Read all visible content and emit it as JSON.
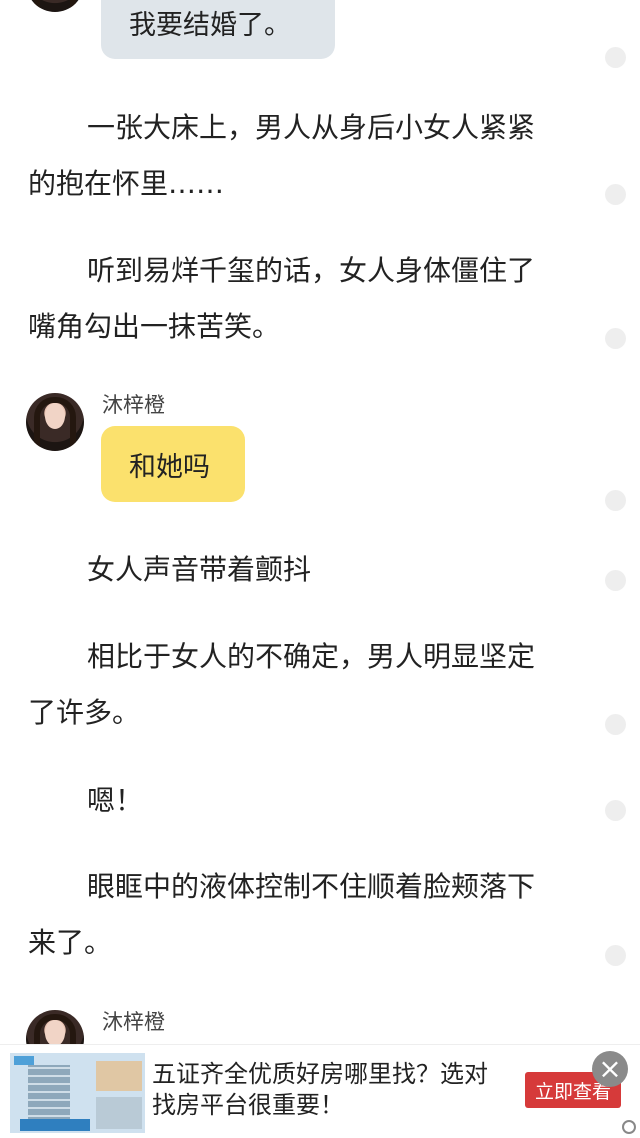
{
  "chat": {
    "msg_top": {
      "text": "我要结婚了。"
    },
    "msg_mid": {
      "sender": "沐梓橙",
      "text": "和她吗"
    },
    "msg_bottom": {
      "sender": "沐梓橙"
    }
  },
  "paragraphs": [
    {
      "lines": [
        "一张大床上，男人从身后小女人紧紧",
        "的抱在怀里……"
      ]
    },
    {
      "lines": [
        "听到易烊千玺的话，女人身体僵住了",
        "嘴角勾出一抹苦笑。"
      ]
    },
    {
      "lines": [
        "女人声音带着颤抖"
      ]
    },
    {
      "lines": [
        "相比于女人的不确定，男人明显坚定",
        "了许多。"
      ]
    },
    {
      "lines": [
        "嗯！"
      ]
    },
    {
      "lines": [
        "眼眶中的液体控制不住顺着脸颊落下",
        "来了。"
      ]
    }
  ],
  "ad": {
    "text_line1": "五证齐全优质好房哪里找？选对",
    "text_line2": "找房平台很重要！",
    "cta": "立即查看",
    "close": "×"
  },
  "colors": {
    "bubble_grey": "#dfe5ea",
    "bubble_yellow": "#fbe16d",
    "cta": "#d63a3a"
  }
}
